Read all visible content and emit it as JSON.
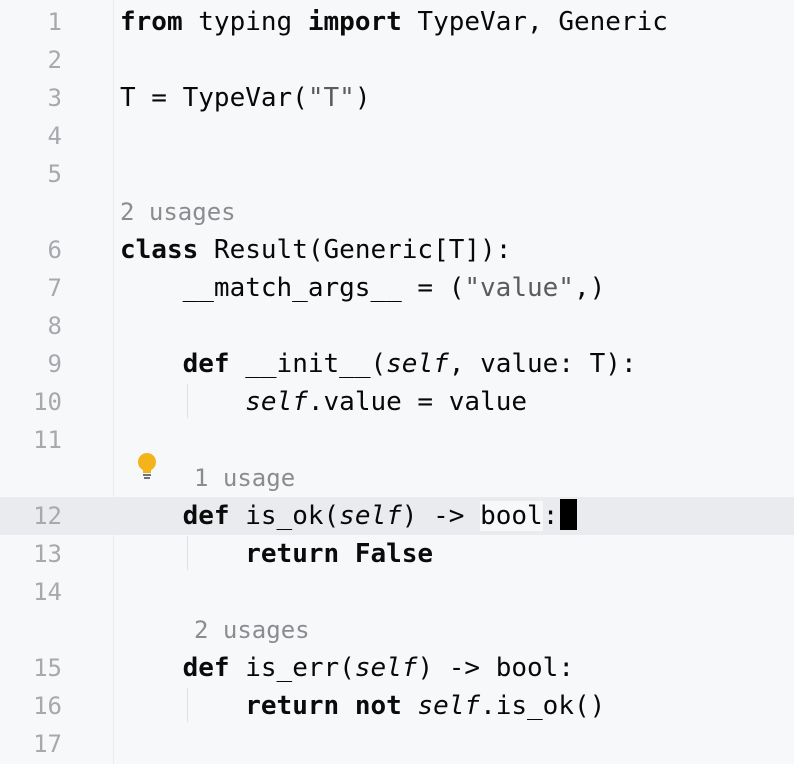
{
  "editor": {
    "lines": {
      "l1": {
        "num": "1",
        "t1": "from",
        "t2": " typing ",
        "t3": "import",
        "t4": " TypeVar, Generic"
      },
      "l2": {
        "num": "2"
      },
      "l3": {
        "num": "3",
        "t1": "T = TypeVar(",
        "t2": "\"T\"",
        "t3": ")"
      },
      "l4": {
        "num": "4"
      },
      "l5": {
        "num": "5"
      },
      "h6": {
        "text": "2 usages"
      },
      "l6": {
        "num": "6",
        "t1": "class",
        "t2": " Result(Generic[T]):"
      },
      "l7": {
        "num": "7",
        "t1": "    __match_args__ = (",
        "t2": "\"value\"",
        "t3": ",)"
      },
      "l8": {
        "num": "8"
      },
      "l9": {
        "num": "9",
        "t1": "    ",
        "t2": "def",
        "t3": " __init__(",
        "t4": "self",
        "t5": ", value: T):"
      },
      "l10": {
        "num": "10",
        "t1": "        ",
        "t2": "self",
        "t3": ".value = value"
      },
      "l11": {
        "num": "11"
      },
      "h12": {
        "text": "1 usage"
      },
      "l12": {
        "num": "12",
        "t1": "    ",
        "t2": "def",
        "t3": " is_ok(",
        "t4": "self",
        "t5": ") -> ",
        "t6": "bool",
        "t7": ":"
      },
      "l13": {
        "num": "13",
        "t1": "        ",
        "t2": "return",
        "t3": " ",
        "t4": "False"
      },
      "l14": {
        "num": "14"
      },
      "h15": {
        "text": "2 usages"
      },
      "l15": {
        "num": "15",
        "t1": "    ",
        "t2": "def",
        "t3": " is_err(",
        "t4": "self",
        "t5": ") -> bool:"
      },
      "l16": {
        "num": "16",
        "t1": "        ",
        "t2": "return",
        "t3": " ",
        "t4": "not",
        "t5": " ",
        "t6": "self",
        "t7": ".is_ok()"
      },
      "l17": {
        "num": "17"
      }
    }
  },
  "colors": {
    "background": "#f7f8fa",
    "current_line": "#eaebee",
    "line_number": "#a7a9ad",
    "keyword": "#0b0b0b",
    "string": "#5c5c5c",
    "inlay_hint": "#8a8c90",
    "bulb": "#f2b31b"
  },
  "icons": {
    "intention": "lightbulb-icon"
  }
}
